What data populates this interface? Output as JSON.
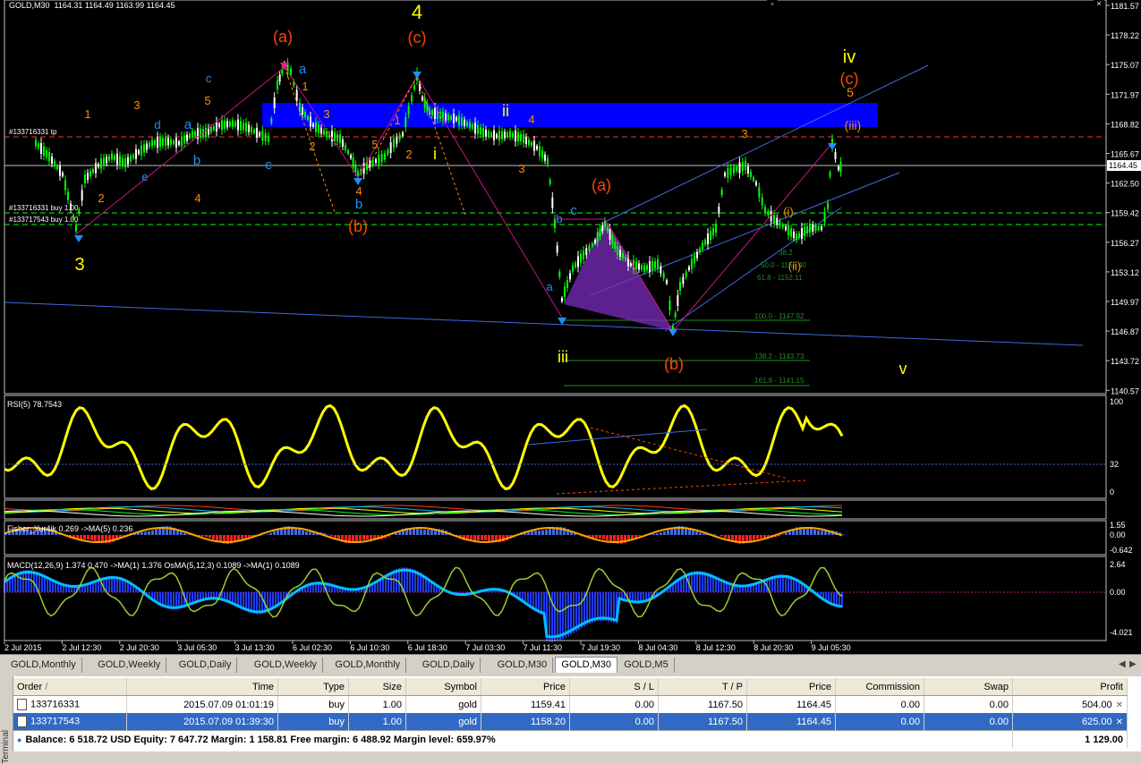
{
  "chart": {
    "title": "GOLD,M30",
    "ohlc": "1164.31 1164.49 1163.99 1164.45",
    "current_price": "1164.45",
    "price_ticks": [
      "1181.57",
      "1178.22",
      "1175.07",
      "1171.97",
      "1168.82",
      "1165.67",
      "1162.50",
      "1159.42",
      "1156.27",
      "1153.12",
      "1149.97",
      "1146.87",
      "1143.72",
      "1140.57"
    ],
    "time_ticks": [
      "2 Jul 2015",
      "2 Jul 12:30",
      "2 Jul 20:30",
      "3 Jul 05:30",
      "3 Jul 13:30",
      "6 Jul 02:30",
      "6 Jul 10:30",
      "6 Jul 18:30",
      "7 Jul 03:30",
      "7 Jul 11:30",
      "7 Jul 19:30",
      "8 Jul 04:30",
      "8 Jul 12:30",
      "8 Jul 20:30",
      "9 Jul 05:30"
    ],
    "order_labels": [
      "#133716331 tp",
      "#133716331 buy 1.00",
      "#133717543 buy 1.00"
    ],
    "fib_labels": [
      "100.0 - 1147.92",
      "138.2 - 1143.73",
      "161.8 - 1141.15",
      "61.8 - 1152.11",
      "38.2",
      "50.0 - 1152.40"
    ],
    "wave_labels": [
      {
        "t": "4",
        "c": "#ffff00",
        "s": 22
      },
      {
        "t": "(a)",
        "c": "#ff4500",
        "s": 18
      },
      {
        "t": "(c)",
        "c": "#ff4500",
        "s": 18
      },
      {
        "t": "iv",
        "c": "#ffff00",
        "s": 20
      },
      {
        "t": "(c)",
        "c": "#ff4500",
        "s": 18
      },
      {
        "t": "3",
        "c": "#ffff00",
        "s": 20
      },
      {
        "t": "(b)",
        "c": "#ff4500",
        "s": 18
      },
      {
        "t": "(a)",
        "c": "#ff4500",
        "s": 18
      },
      {
        "t": "iii",
        "c": "#ffff00",
        "s": 18
      },
      {
        "t": "(b)",
        "c": "#ff4500",
        "s": 18
      },
      {
        "t": "v",
        "c": "#ffff00",
        "s": 18
      },
      {
        "t": "ii",
        "c": "#ffff00",
        "s": 18
      },
      {
        "t": "i",
        "c": "#ffff00",
        "s": 18
      },
      {
        "t": "5",
        "c": "#ff8c00",
        "s": 14
      },
      {
        "t": "(iii)",
        "c": "#ff8c00",
        "s": 14
      },
      {
        "t": "(i)",
        "c": "#ff8c00",
        "s": 13
      },
      {
        "t": "(ii)",
        "c": "#ff8c00",
        "s": 13
      },
      {
        "t": "3",
        "c": "#ff8c00",
        "s": 13
      },
      {
        "t": "1",
        "c": "#ff8c00",
        "s": 13
      },
      {
        "t": "2",
        "c": "#ff8c00",
        "s": 13
      },
      {
        "t": "3",
        "c": "#ff8c00",
        "s": 13
      },
      {
        "t": "4",
        "c": "#ff8c00",
        "s": 13
      },
      {
        "t": "5",
        "c": "#ff8c00",
        "s": 13
      },
      {
        "t": "1",
        "c": "#ff8c00",
        "s": 13
      },
      {
        "t": "2",
        "c": "#ff8c00",
        "s": 13
      },
      {
        "t": "3",
        "c": "#ff8c00",
        "s": 13
      },
      {
        "t": "4",
        "c": "#ff8c00",
        "s": 13
      },
      {
        "t": "5",
        "c": "#ff8c00",
        "s": 13
      },
      {
        "t": "1",
        "c": "#ff8c00",
        "s": 13
      },
      {
        "t": "2",
        "c": "#ff8c00",
        "s": 13
      },
      {
        "t": "3",
        "c": "#ff8c00",
        "s": 13
      },
      {
        "t": "4",
        "c": "#ff8c00",
        "s": 13
      },
      {
        "t": "a",
        "c": "#1e90ff",
        "s": 13
      },
      {
        "t": "b",
        "c": "#1e90ff",
        "s": 13
      },
      {
        "t": "c",
        "c": "#1e90ff",
        "s": 13
      },
      {
        "t": "d",
        "c": "#1e90ff",
        "s": 13
      },
      {
        "t": "e",
        "c": "#1e90ff",
        "s": 13
      },
      {
        "t": "a",
        "c": "#1e90ff",
        "s": 15
      },
      {
        "t": "b",
        "c": "#1e90ff",
        "s": 15
      },
      {
        "t": "c",
        "c": "#1e90ff",
        "s": 15
      },
      {
        "t": "a",
        "c": "#1e90ff",
        "s": 15
      },
      {
        "t": "b",
        "c": "#1e90ff",
        "s": 15
      },
      {
        "t": "c",
        "c": "#1e90ff",
        "s": 15
      }
    ],
    "rsi_label": "RSI(5) 78.7543",
    "rsi_levels": [
      "100",
      "32",
      "0"
    ],
    "fisher_label": "Fisher_Yur4ik 0.269 ->MA(5) 0.236",
    "fisher_ticks": [
      "1.55",
      "0.00",
      "-0.642"
    ],
    "macd_label": "MACD(12,26,9) 1.374 0.470 ->MA(1) 1.376 OsMA(5,12,3) 0.1089 ->MA(1) 0.1089",
    "macd_ticks": [
      "2.64",
      "0.00",
      "-4.021"
    ]
  },
  "tabs": [
    "GOLD,Monthly",
    "GOLD,Weekly",
    "GOLD,Daily",
    "GOLD,Weekly",
    "GOLD,Monthly",
    "GOLD,Daily",
    "GOLD,M30",
    "GOLD,M30",
    "GOLD,M5"
  ],
  "active_tab_index": 7,
  "terminal": {
    "side_label": "Terminal",
    "headers": [
      "Order",
      "/",
      "Time",
      "Type",
      "Size",
      "Symbol",
      "Price",
      "S / L",
      "T / P",
      "Price",
      "Commission",
      "Swap",
      "Profit"
    ],
    "rows": [
      {
        "order": "133716331",
        "time": "2015.07.09 01:01:19",
        "type": "buy",
        "size": "1.00",
        "symbol": "gold",
        "price": "1159.41",
        "sl": "0.00",
        "tp": "1167.50",
        "cur": "1164.45",
        "commission": "0.00",
        "swap": "0.00",
        "profit": "504.00"
      },
      {
        "order": "133717543",
        "time": "2015.07.09 01:39:30",
        "type": "buy",
        "size": "1.00",
        "symbol": "gold",
        "price": "1158.20",
        "sl": "0.00",
        "tp": "1167.50",
        "cur": "1164.45",
        "commission": "0.00",
        "swap": "0.00",
        "profit": "625.00"
      }
    ],
    "balance_line": "Balance: 6 518.72 USD  Equity: 7 647.72  Margin: 1 158.81  Free margin: 6 488.92  Margin level: 659.97%",
    "total_profit": "1 129.00"
  },
  "colors": {
    "bull": "#00ff00",
    "bear": "#ffffff",
    "rsi": "#ffff00",
    "macd_hist": "#1e3cff",
    "signal": "#00bfff",
    "band": "#0000ff"
  }
}
